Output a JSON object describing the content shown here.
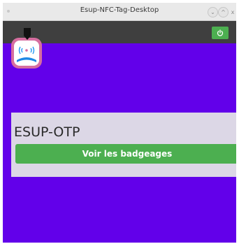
{
  "window": {
    "title": "Esup-NFC-Tag-Desktop",
    "controls": [
      "minimize",
      "maximize",
      "close"
    ]
  },
  "appbar": {
    "power_icon": "power-icon",
    "power_color": "#4caf50",
    "background": "#3f3f3f"
  },
  "content": {
    "background": "#6200ea",
    "logo_icon": "nfc-logo-icon",
    "card": {
      "title": "ESUP-OTP",
      "button_label": "Voir les badgeages",
      "button_color": "#4caf50"
    }
  },
  "glyphs": {
    "minimize": "⌄",
    "maximize": "^",
    "close": "x"
  }
}
